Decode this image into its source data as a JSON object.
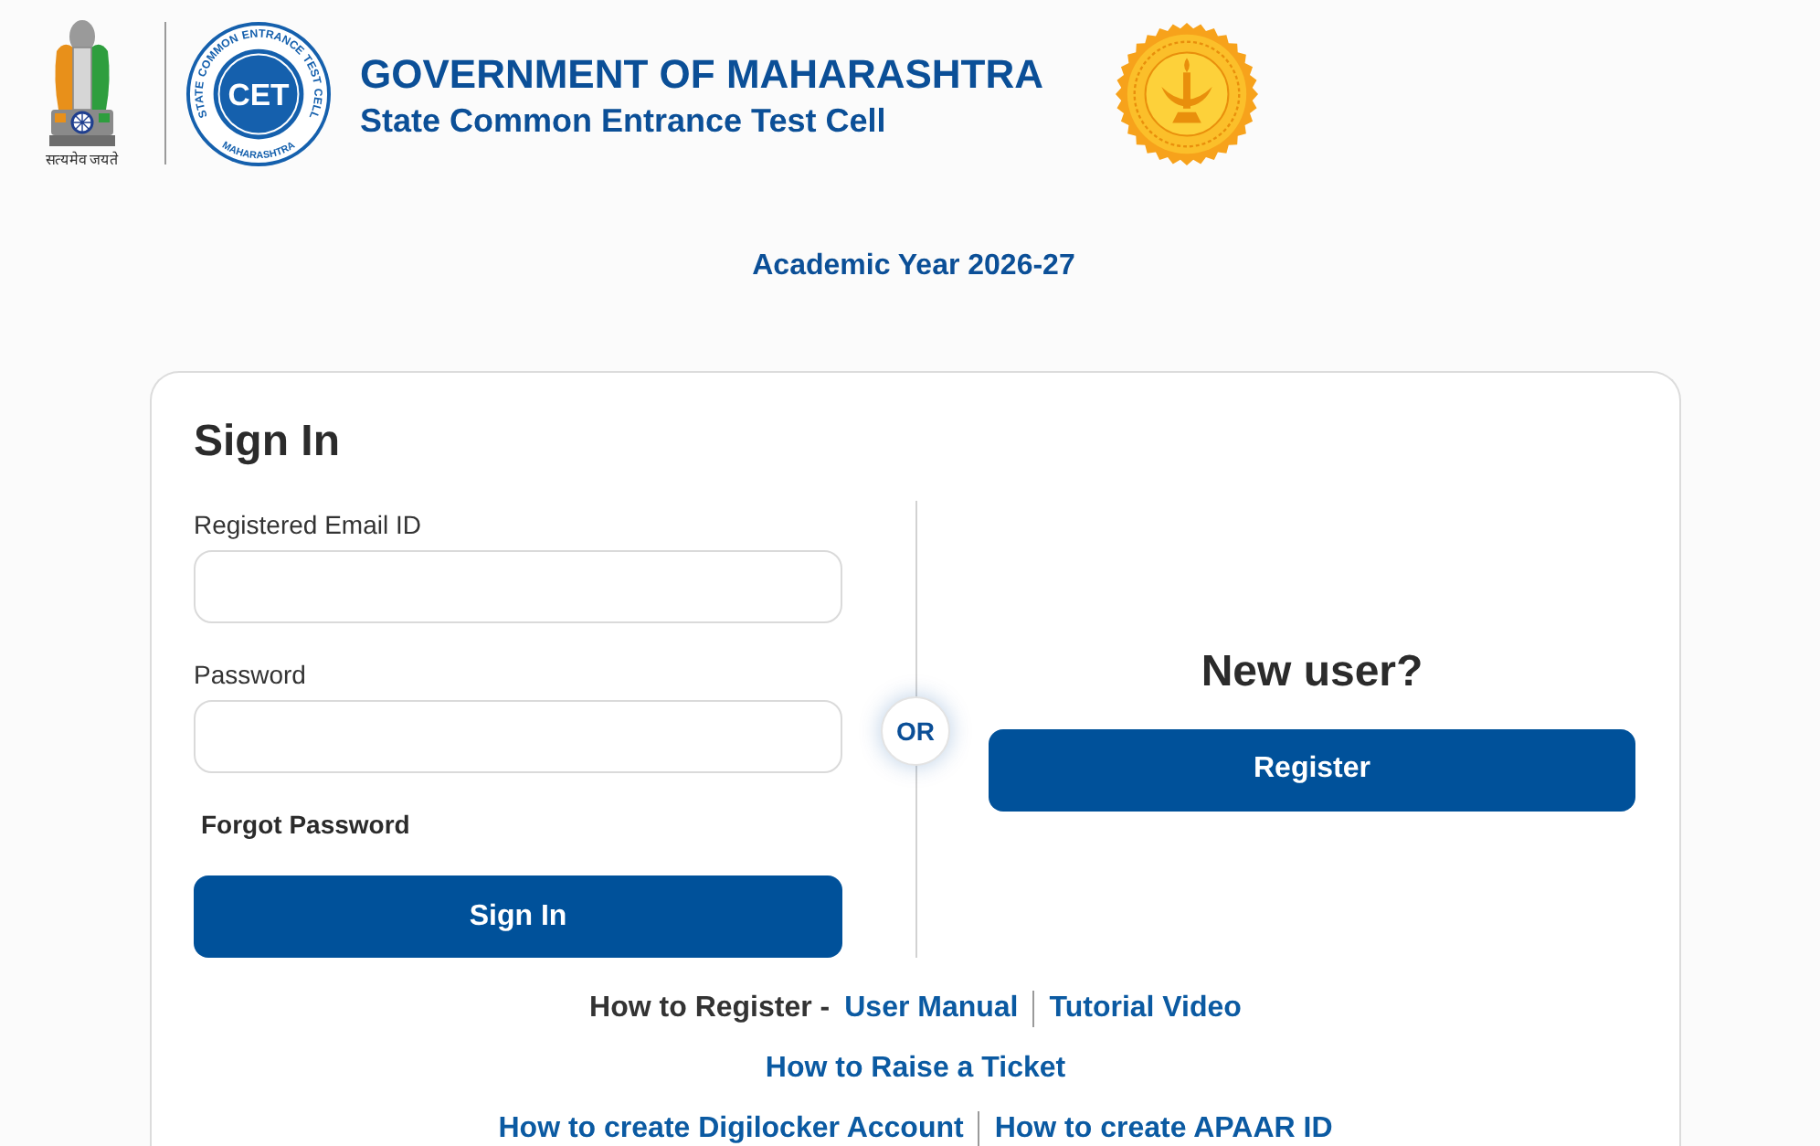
{
  "header": {
    "emblem_motto": "सत्यमेव जयते",
    "cet_logo": {
      "center_text": "CET",
      "ring_words": [
        "STATE",
        "COMMON",
        "ENTRANCE",
        "TEST",
        "CELL"
      ],
      "bottom_text": "MAHARASHTRA"
    },
    "title": "GOVERNMENT OF MAHARASHTRA",
    "subtitle": "State Common Entrance Test Cell"
  },
  "academic_year": "Academic Year 2026-27",
  "sign_in": {
    "title": "Sign In",
    "fields": [
      {
        "label": "Registered Email ID"
      },
      {
        "label": "Password"
      }
    ],
    "forgot_link": "Forgot Password",
    "button": "Sign In"
  },
  "separator": "OR",
  "register": {
    "heading": "New user?",
    "button": "Register"
  },
  "help_links": [
    {
      "items": [
        {
          "kind": "text",
          "text": "How to Register -"
        },
        {
          "kind": "link",
          "text": "User Manual"
        },
        {
          "kind": "link",
          "text": "Tutorial Video"
        }
      ]
    },
    {
      "items": [
        {
          "kind": "link",
          "text": "How to Raise a Ticket"
        }
      ]
    },
    {
      "items": [
        {
          "kind": "link",
          "text": "How to create Digilocker Account"
        },
        {
          "kind": "link",
          "text": "How to create APAAR ID"
        }
      ]
    }
  ]
}
